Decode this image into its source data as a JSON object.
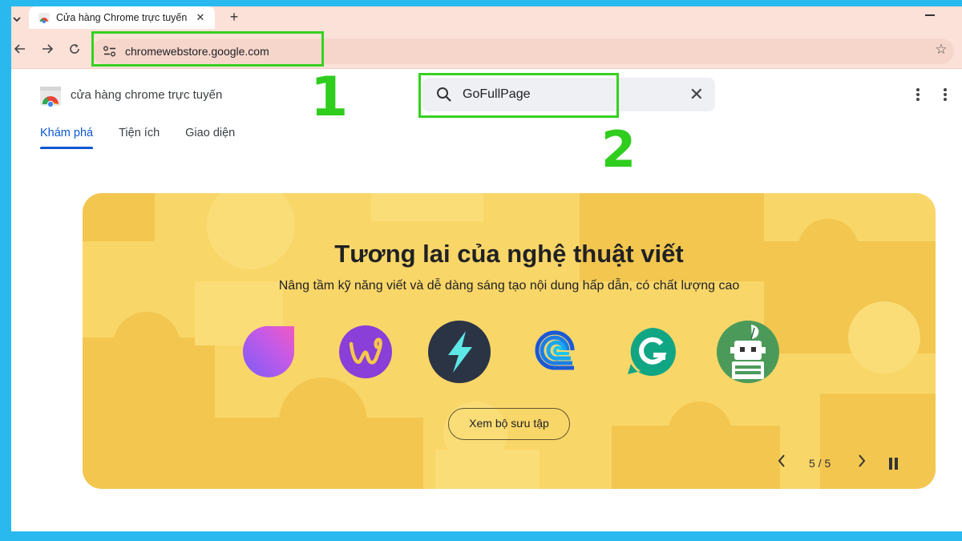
{
  "browser": {
    "tab_title": "Cửa hàng Chrome trực tuyến",
    "tab_close": "✕",
    "new_tab": "+",
    "url": "chromewebstore.google.com"
  },
  "annotations": {
    "label_1": "1",
    "label_2": "2",
    "color": "#35d11f"
  },
  "store": {
    "name": "cửa hàng chrome trực tuyến",
    "search_value": "GoFullPage",
    "search_clear": "✕",
    "tabs": [
      {
        "label": "Khám phá",
        "active": true
      },
      {
        "label": "Tiện ích",
        "active": false
      },
      {
        "label": "Giao diện",
        "active": false
      }
    ]
  },
  "banner": {
    "title": "Tương lai của nghệ thuật viết",
    "subtitle": "Nâng tầm kỹ năng viết và dễ dàng sáng tạo nội dung hấp dẫn, có chất lượng cao",
    "button": "Xem bộ sưu tập",
    "pager": "5 / 5",
    "background_color": "#f9d668",
    "icons": [
      "gradient-drop-icon",
      "purple-w-icon",
      "lightning-bolt-icon",
      "blue-swirl-icon",
      "grammarly-g-icon",
      "robot-quill-icon"
    ]
  }
}
